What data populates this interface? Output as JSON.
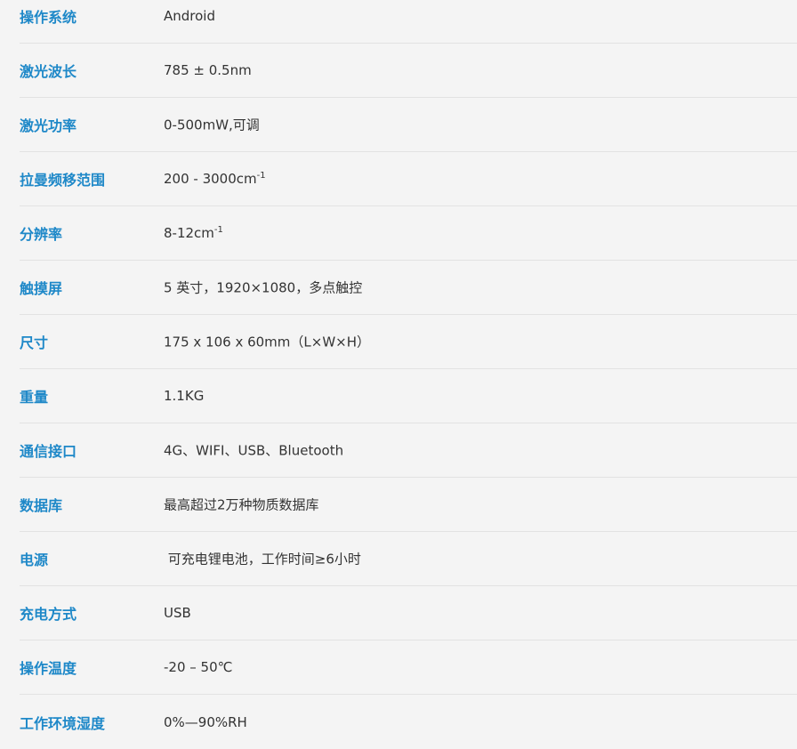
{
  "specs": [
    {
      "label": "操作系统",
      "value": "Android",
      "sup": ""
    },
    {
      "label": "激光波长",
      "value": "785 ± 0.5nm",
      "sup": ""
    },
    {
      "label": "激光功率",
      "value": "0-500mW,可调",
      "sup": ""
    },
    {
      "label": "拉曼频移范围",
      "value": "200 - 3000cm",
      "sup": "-1"
    },
    {
      "label": "分辨率",
      "value": "8-12cm",
      "sup": "-1"
    },
    {
      "label": "触摸屏",
      "value": "5 英寸，1920×1080，多点触控",
      "sup": ""
    },
    {
      "label": "尺寸",
      "value": "175 x 106 x 60mm（L×W×H）",
      "sup": ""
    },
    {
      "label": "重量",
      "value": "1.1KG",
      "sup": ""
    },
    {
      "label": "通信接口",
      "value": "4G、WIFI、USB、Bluetooth",
      "sup": ""
    },
    {
      "label": "数据库",
      "value": "最高超过2万种物质数据库",
      "sup": ""
    },
    {
      "label": "电源",
      "value": " 可充电锂电池，工作时间≥6小时",
      "sup": ""
    },
    {
      "label": "充电方式",
      "value": "USB",
      "sup": ""
    },
    {
      "label": "操作温度",
      "value": "-20 – 50℃",
      "sup": ""
    },
    {
      "label": "工作环境湿度",
      "value": "0%—90%RH",
      "sup": ""
    }
  ]
}
